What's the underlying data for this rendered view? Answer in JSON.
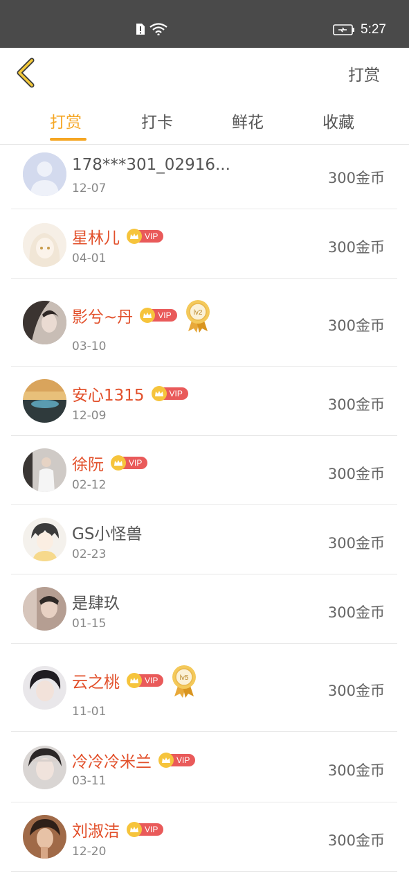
{
  "status_bar": {
    "time": "5:27"
  },
  "header": {
    "action_label": "打赏"
  },
  "tabs": [
    {
      "label": "打赏",
      "active": true
    },
    {
      "label": "打卡",
      "active": false
    },
    {
      "label": "鲜花",
      "active": false
    },
    {
      "label": "收藏",
      "active": false
    }
  ],
  "colors": {
    "accent": "#f5a623",
    "vip_name": "#e2502b",
    "vip_tag": "#e95a5a"
  },
  "rewards": [
    {
      "name": "178***301_02916...",
      "date": "12-07",
      "amount": "300金币",
      "vip": false,
      "vip_label": "",
      "medal": ""
    },
    {
      "name": "星林儿",
      "date": "04-01",
      "amount": "300金币",
      "vip": true,
      "vip_label": "VIP",
      "medal": ""
    },
    {
      "name": "影兮~丹",
      "date": "03-10",
      "amount": "300金币",
      "vip": true,
      "vip_label": "VIP",
      "medal": "lv2"
    },
    {
      "name": "安心1315",
      "date": "12-09",
      "amount": "300金币",
      "vip": true,
      "vip_label": "VIP",
      "medal": ""
    },
    {
      "name": "徐阮",
      "date": "02-12",
      "amount": "300金币",
      "vip": true,
      "vip_label": "VIP",
      "medal": ""
    },
    {
      "name": "GS小怪兽",
      "date": "02-23",
      "amount": "300金币",
      "vip": false,
      "vip_label": "",
      "medal": ""
    },
    {
      "name": "是肆玖",
      "date": "01-15",
      "amount": "300金币",
      "vip": false,
      "vip_label": "",
      "medal": ""
    },
    {
      "name": "云之桃",
      "date": "11-01",
      "amount": "300金币",
      "vip": true,
      "vip_label": "VIP",
      "medal": "lv5"
    },
    {
      "name": "冷冷冷米兰",
      "date": "03-11",
      "amount": "300金币",
      "vip": true,
      "vip_label": "VIP",
      "medal": ""
    },
    {
      "name": "刘淑洁",
      "date": "12-20",
      "amount": "300金币",
      "vip": true,
      "vip_label": "VIP",
      "medal": ""
    }
  ]
}
